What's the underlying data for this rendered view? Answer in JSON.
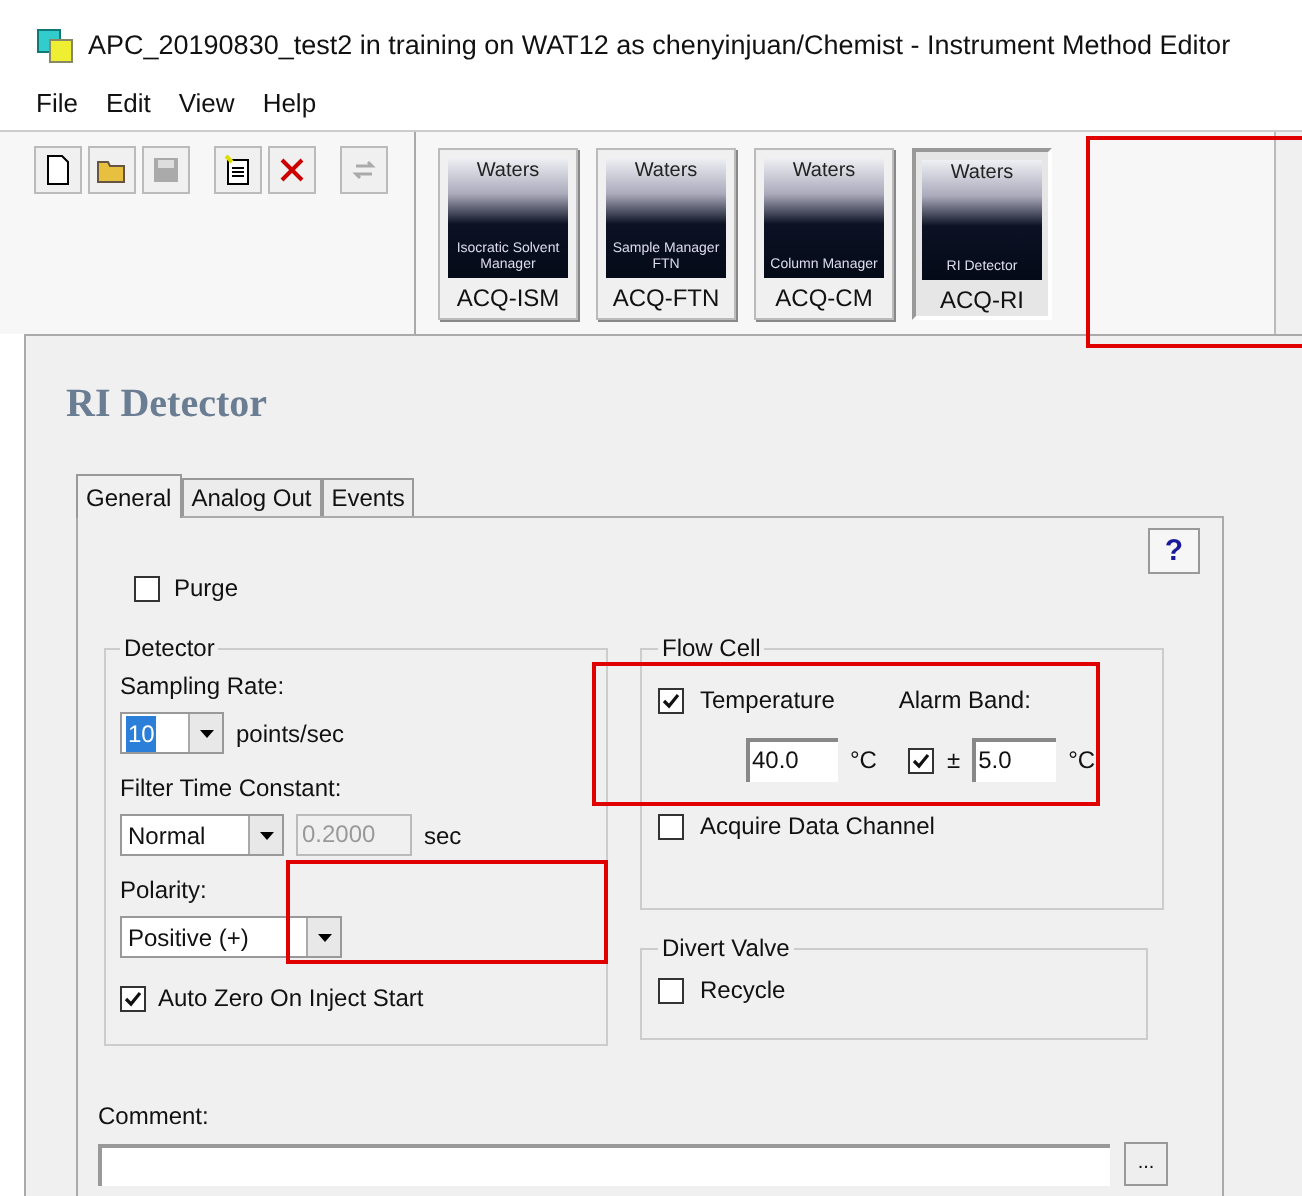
{
  "window": {
    "title": "APC_20190830_test2 in training on WAT12 as chenyinjuan/Chemist - Instrument Method Editor"
  },
  "menu": [
    "File",
    "Edit",
    "View",
    "Help"
  ],
  "modules": [
    {
      "brand": "Waters",
      "caption": "Isocratic Solvent Manager",
      "label": "ACQ-ISM",
      "selected": false
    },
    {
      "brand": "Waters",
      "caption": "Sample Manager FTN",
      "label": "ACQ-FTN",
      "selected": false
    },
    {
      "brand": "Waters",
      "caption": "Column Manager",
      "label": "ACQ-CM",
      "selected": false
    },
    {
      "brand": "Waters",
      "caption": "RI Detector",
      "label": "ACQ-RI",
      "selected": true
    }
  ],
  "panel_title": "RI Detector",
  "tabs": [
    {
      "label": "General",
      "selected": true
    },
    {
      "label": "Analog Out",
      "selected": false
    },
    {
      "label": "Events",
      "selected": false
    }
  ],
  "help_button": "?",
  "purge": {
    "label": "Purge",
    "checked": false
  },
  "detector": {
    "title": "Detector",
    "sampling_rate_label": "Sampling Rate:",
    "sampling_rate": {
      "value": "10",
      "highlighted": true
    },
    "sampling_rate_unit": "points/sec",
    "filter_label": "Filter Time Constant:",
    "filter_value": "Normal",
    "filter_time": {
      "value": "0.2000",
      "disabled": true
    },
    "filter_unit": "sec",
    "polarity_label": "Polarity:",
    "polarity_value": "Positive (+)",
    "auto_zero": {
      "label": "Auto Zero On Inject Start",
      "checked": true
    }
  },
  "flow_cell": {
    "title": "Flow Cell",
    "temperature": {
      "label": "Temperature",
      "checked": true
    },
    "alarm_band_label": "Alarm Band:",
    "temperature_value": "40.0",
    "temperature_unit": "°C",
    "alarm_band": {
      "checked": true
    },
    "plus_minus": "±",
    "alarm_value": "5.0",
    "alarm_unit": "°C",
    "acquire": {
      "label": "Acquire Data Channel",
      "checked": false
    }
  },
  "divert_valve": {
    "title": "Divert Valve",
    "recycle": {
      "label": "Recycle",
      "checked": false
    }
  },
  "comment": {
    "label": "Comment:",
    "browse_button": "..."
  },
  "annotations": [
    {
      "kind": "highlight",
      "color": "#e00000"
    },
    {
      "kind": "highlight",
      "color": "#e00000"
    },
    {
      "kind": "highlight",
      "color": "#e00000"
    }
  ]
}
